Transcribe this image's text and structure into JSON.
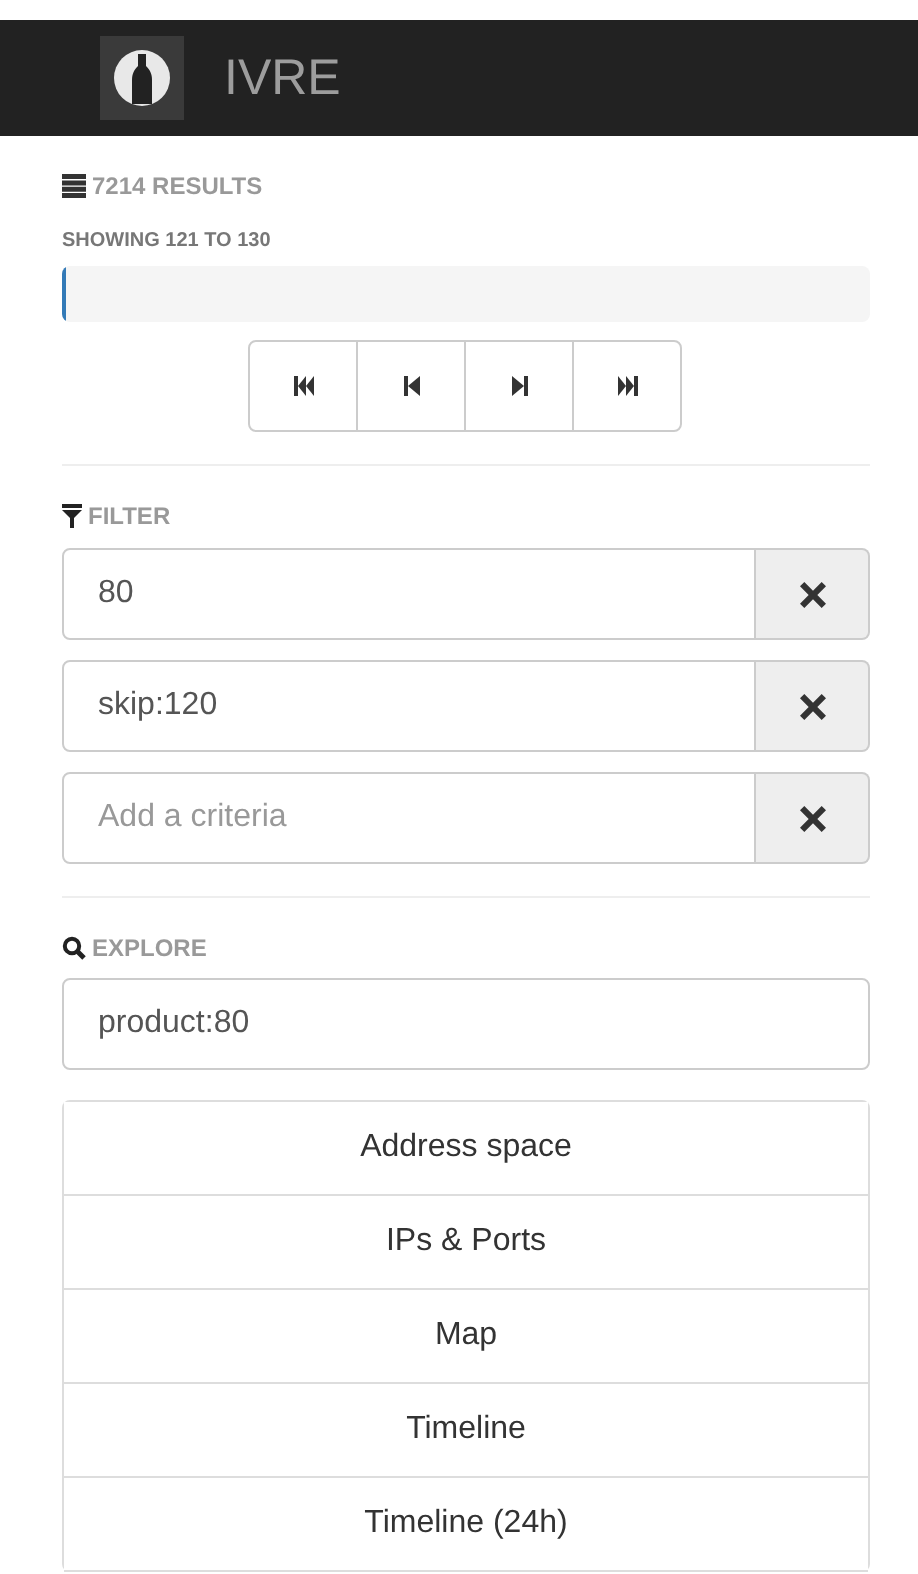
{
  "navbar": {
    "brand": "IVRE"
  },
  "results": {
    "count": "7214 RESULTS",
    "showing": "SHOWING 121 TO 130",
    "level": 0.005
  },
  "pager": [
    {
      "kind": "first"
    },
    {
      "kind": "prev"
    },
    {
      "kind": "next"
    },
    {
      "kind": "last"
    }
  ],
  "filter": {
    "title": "FILTER",
    "criteria": [
      {
        "value": "80"
      },
      {
        "value": "skip:120"
      },
      {
        "placeholder": "Add a criteria"
      }
    ]
  },
  "explore": {
    "title": "EXPLORE",
    "value": "product:80",
    "items": [
      "Address space",
      "IPs & Ports",
      "Map",
      "Timeline",
      "Timeline (24h)"
    ]
  }
}
